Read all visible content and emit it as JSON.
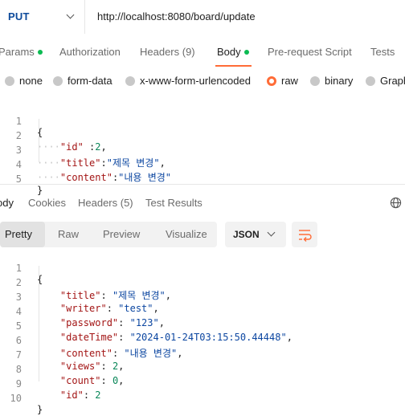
{
  "request": {
    "method": "PUT",
    "url": "http://localhost:8080/board/update"
  },
  "request_tabs": [
    {
      "label": "Params",
      "dot": true
    },
    {
      "label": "Authorization",
      "dot": false
    },
    {
      "label": "Headers (9)",
      "dot": false
    },
    {
      "label": "Body",
      "dot": true,
      "active": true
    },
    {
      "label": "Pre-request Script",
      "dot": false
    },
    {
      "label": "Tests",
      "dot": false
    }
  ],
  "body_types": [
    {
      "label": "none",
      "selected": false
    },
    {
      "label": "form-data",
      "selected": false
    },
    {
      "label": "x-www-form-urlencoded",
      "selected": false
    },
    {
      "label": "raw",
      "selected": true
    },
    {
      "label": "binary",
      "selected": false
    },
    {
      "label": "Graph",
      "selected": false
    }
  ],
  "request_body": {
    "line_numbers": [
      "1",
      "2",
      "3",
      "4",
      "5"
    ],
    "lines": [
      {
        "open": "{"
      },
      {
        "key": "\"id\"",
        "sep": " :",
        "value": "2",
        "value_kind": "number",
        "trail": ","
      },
      {
        "key": "\"title\"",
        "sep": ":",
        "value": "\"제목 변경\"",
        "value_kind": "string",
        "trail": ","
      },
      {
        "key": "\"content\"",
        "sep": ":",
        "value": "\"내용 변경\"",
        "value_kind": "string",
        "trail": ""
      },
      {
        "close": "}"
      }
    ]
  },
  "response_tabs": [
    {
      "label": "ody",
      "active": true
    },
    {
      "label": "Cookies"
    },
    {
      "label": "Headers (5)"
    },
    {
      "label": "Test Results"
    }
  ],
  "view_modes": [
    {
      "label": "Pretty",
      "active": true
    },
    {
      "label": "Raw"
    },
    {
      "label": "Preview"
    },
    {
      "label": "Visualize"
    }
  ],
  "format": {
    "label": "JSON"
  },
  "response_body": {
    "line_numbers": [
      "1",
      "2",
      "3",
      "4",
      "5",
      "6",
      "7",
      "8",
      "9",
      "10"
    ],
    "lines": [
      {
        "open": "{"
      },
      {
        "key": "\"title\"",
        "value": "\"제목 변경\"",
        "value_kind": "string",
        "trail": ","
      },
      {
        "key": "\"writer\"",
        "value": "\"test\"",
        "value_kind": "string",
        "trail": ","
      },
      {
        "key": "\"password\"",
        "value": "\"123\"",
        "value_kind": "string",
        "trail": ","
      },
      {
        "key": "\"dateTime\"",
        "value": "\"2024-01-24T03:15:50.44448\"",
        "value_kind": "string",
        "trail": ","
      },
      {
        "key": "\"content\"",
        "value": "\"내용 변경\"",
        "value_kind": "string",
        "trail": ","
      },
      {
        "key": "\"views\"",
        "value": "2",
        "value_kind": "number",
        "trail": ","
      },
      {
        "key": "\"count\"",
        "value": "0",
        "value_kind": "number",
        "trail": ","
      },
      {
        "key": "\"id\"",
        "value": "2",
        "value_kind": "number",
        "trail": ""
      },
      {
        "close": "}"
      }
    ]
  },
  "colors": {
    "accent": "#ff6c37",
    "method": "#0d4a9b",
    "key": "#a31515",
    "string": "#0d47a1",
    "number": "#098658",
    "dot": "#0cbb52"
  },
  "icons": {
    "method_dropdown": "chevron-down-icon",
    "globe": "globe-icon",
    "format_dropdown": "chevron-down-icon",
    "wrap": "wrap-lines-icon"
  }
}
